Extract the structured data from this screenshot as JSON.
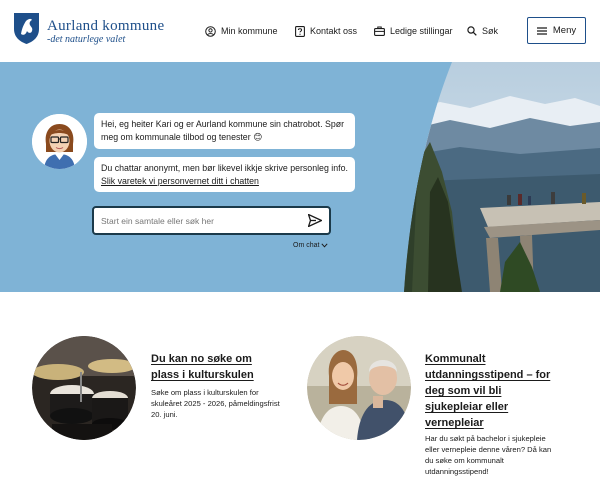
{
  "header": {
    "brand_name": "Aurland kommune",
    "brand_tagline": "-det naturlege valet",
    "nav": [
      {
        "label": "Min kommune",
        "icon": "user-circle-icon"
      },
      {
        "label": "Kontakt oss",
        "icon": "question-square-icon"
      },
      {
        "label": "Ledige stillingar",
        "icon": "briefcase-icon"
      },
      {
        "label": "Søk",
        "icon": "search-icon"
      }
    ],
    "menu_label": "Meny"
  },
  "chat": {
    "bubble1": "Hei, eg heiter Kari og er Aurland kommune sin chatrobot. Spør meg om kommunale tilbod og tenester 😊",
    "bubble2_text": "Du chattar anonymt, men bør likevel ikkje skrive personleg info.",
    "bubble2_link": "Slik varetek vi personvernet ditt i chatten",
    "search_placeholder": "Start ein samtale eller søk her",
    "om_chat": "Om chat"
  },
  "cards": [
    {
      "title": "Du kan no søke om plass i kulturskulen",
      "text": "Søke om plass i kulturskulen for skuleåret 2025 - 2026, påmeldingsfrist 20. juni."
    },
    {
      "title": "Kommunalt utdanningsstipend – for deg som vil bli sjukepleiar eller vernepleiar",
      "text": "Har du søkt på bachelor i sjukepleie eller vernepleie denne våren? Då kan du søke om kommunalt utdanningsstipend!"
    }
  ],
  "colors": {
    "brand": "#1e4f8a",
    "hero_bg": "#7fb3d6",
    "search_border": "#1b3a4a"
  }
}
